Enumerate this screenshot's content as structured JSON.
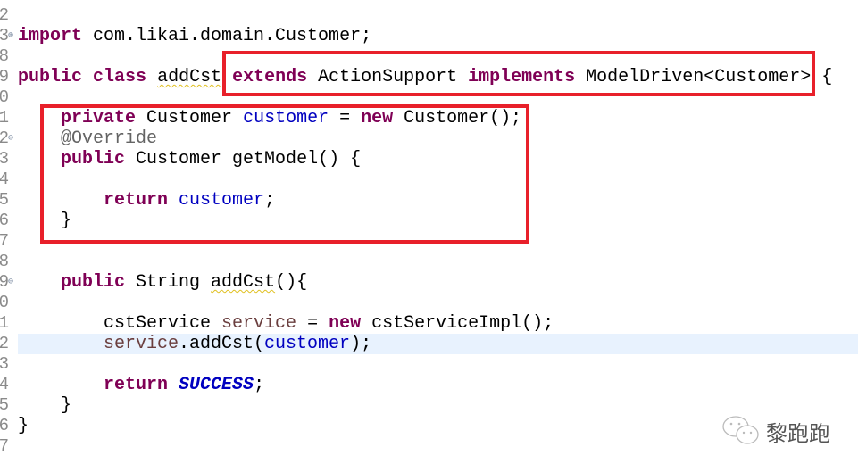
{
  "editor": {
    "line_numbers": [
      "2",
      "3",
      "8",
      "9",
      "0",
      "1",
      "2",
      "3",
      "4",
      "5",
      "6",
      "7",
      "8",
      "9",
      "0",
      "1",
      "2",
      "3",
      "4",
      "5",
      "6",
      "7"
    ],
    "highlighted_line_index": 17,
    "code": {
      "import_kw": "import",
      "import_path": " com.likai.domain.Customer;",
      "public_kw": "public",
      "class_kw": "class",
      "class_name": "addCst",
      "extends_kw": "extends",
      "super_class": " ActionSupport ",
      "implements_kw": "implements",
      "interface": " ModelDriven<Customer>",
      "open_brace": " {",
      "private_kw": "private",
      "field_type": " Customer ",
      "field_name": "customer",
      "assign": " = ",
      "new_kw": "new",
      "ctor": " Customer();",
      "override": "@Override",
      "getmodel_sig": " Customer getModel() {",
      "return_kw": "return",
      "return_customer": "customer",
      "semicolon": ";",
      "close_brace": "}",
      "string_type": " String ",
      "method_name": "addCst",
      "method_paren": "(){",
      "svc_type": "cstService ",
      "svc_var": "service",
      "svc_impl": " cstServiceImpl();",
      "call_prefix": ".addCst(",
      "call_suffix": ");",
      "success": "SUCCESS"
    }
  },
  "watermark": {
    "text": "黎跑跑",
    "icon": "wechat-icon"
  },
  "colors": {
    "highlight_box": "#e8202a",
    "keyword": "#7f0055",
    "field": "#0000c0",
    "current_line": "#e8f2fe"
  }
}
